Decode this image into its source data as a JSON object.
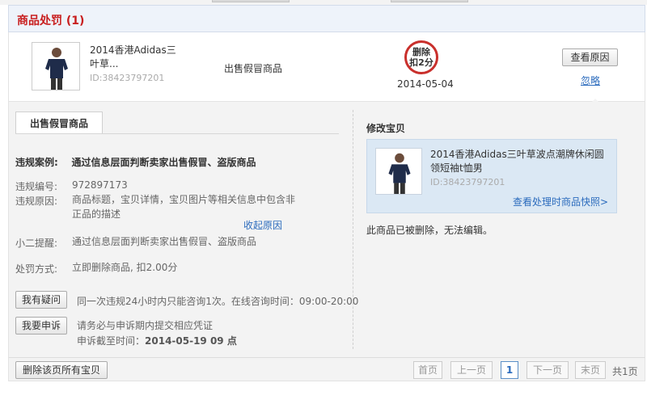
{
  "header": {
    "title": "商品处罚 (1)"
  },
  "item": {
    "title": "2014香港Adidas三叶草...",
    "id_label": "ID:38423797201",
    "violation": "出售假冒商品",
    "stamp_text_1": "删除",
    "stamp_text_2": "扣2分",
    "date": "2014-05-04",
    "view_reason_btn": "查看原因",
    "ignore_link": "忽略"
  },
  "details": {
    "tab_label": "出售假冒商品",
    "case_label": "违规案例:",
    "case_text": "通过信息层面判断卖家出售假冒、盗版商品",
    "rows": [
      {
        "label": "违规编号:",
        "value": "972897173"
      },
      {
        "label": "违规原因:",
        "value": "商品标题，宝贝详情，宝贝图片等相关信息中包含非",
        "value2": "正品的描述"
      },
      {
        "label": "小二提醒:",
        "value": "通过信息层面判断卖家出售假冒、盗版商品"
      },
      {
        "label": "处罚方式:",
        "value": "立即删除商品, 扣2.00分"
      }
    ],
    "collapse_link": "收起原因",
    "ask_btn": "我有疑问",
    "ask_note": "同一次违规24小时内只能咨询1次。在线咨询时间：09:00-20:00",
    "appeal_btn": "我要申诉",
    "appeal_note": "请务必与申诉期内提交相应凭证",
    "appeal_deadline_label": "申诉截至时间：",
    "appeal_deadline": "2014-05-19 09 点"
  },
  "edit": {
    "title": "修改宝贝",
    "product_title": "2014香港Adidas三叶草波点潮牌休闲圆领短袖t恤男",
    "product_id": "ID:38423797201",
    "snapshot_link": "查看处理时商品快照>",
    "deleted_msg": "此商品已被删除，无法编辑。"
  },
  "footer": {
    "delete_all_btn": "删除该页所有宝贝",
    "first": "首页",
    "prev": "上一页",
    "current": "1",
    "next": "下一页",
    "last": "末页",
    "total": "共1页"
  },
  "colors": {
    "accent_red": "#c81e1e",
    "link_blue": "#2b6bbd",
    "card_blue": "#dbe8f4"
  }
}
